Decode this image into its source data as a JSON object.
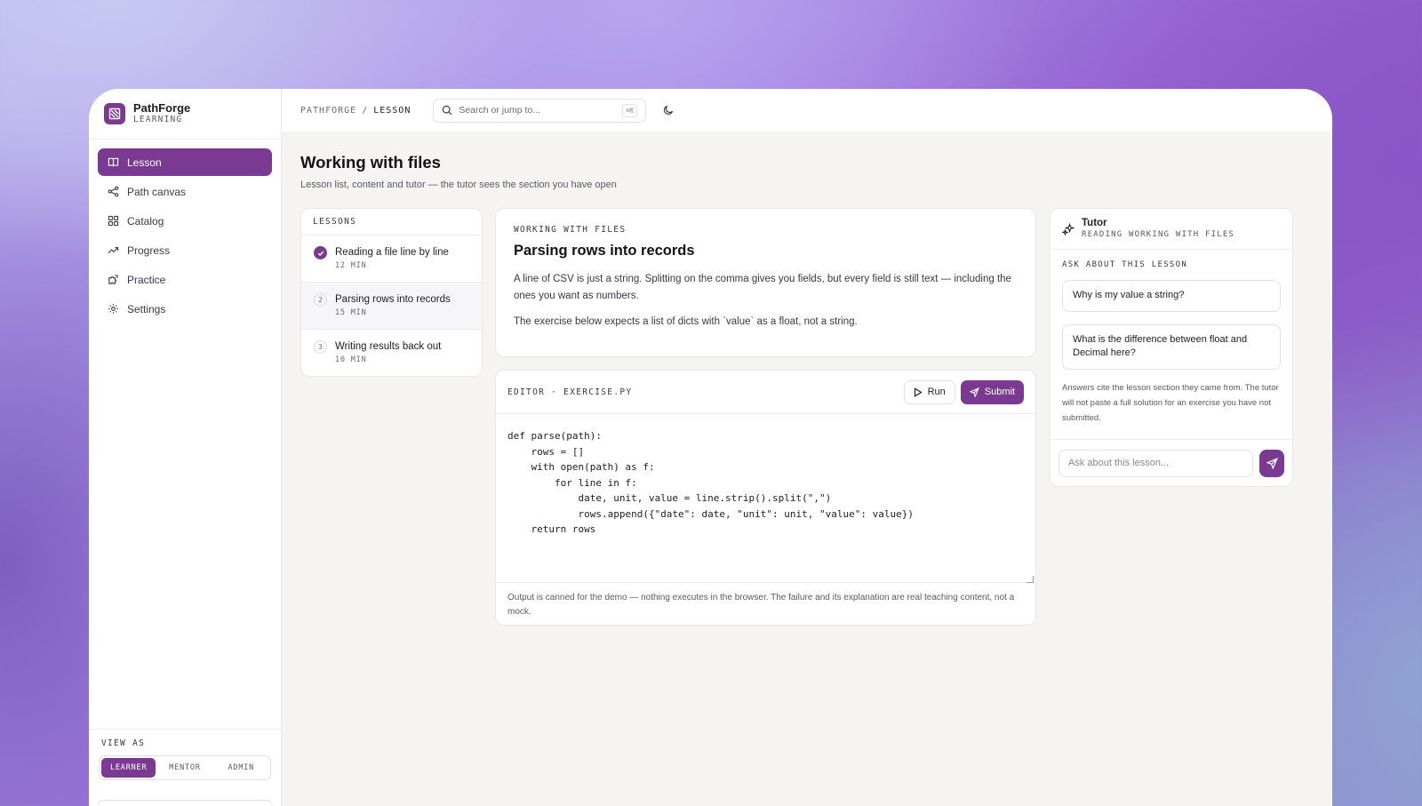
{
  "brand": {
    "name": "PathForge",
    "sub": "LEARNING"
  },
  "nav": [
    {
      "label": "Lesson",
      "icon": "book-icon",
      "active": true
    },
    {
      "label": "Path canvas",
      "icon": "share-nodes-icon"
    },
    {
      "label": "Catalog",
      "icon": "grid-icon"
    },
    {
      "label": "Progress",
      "icon": "trend-up-icon"
    },
    {
      "label": "Practice",
      "icon": "puzzle-icon"
    },
    {
      "label": "Settings",
      "icon": "gear-icon"
    }
  ],
  "view_as": {
    "label": "VIEW AS",
    "options": [
      "LEARNER",
      "MENTOR",
      "ADMIN"
    ],
    "selected": "LEARNER"
  },
  "topbar": {
    "crumb_root": "PATHFORGE",
    "crumb_sep": "/",
    "crumb_current": "LESSON",
    "search_placeholder": "Search or jump to...",
    "search_shortcut": "⌘K"
  },
  "page": {
    "title": "Working with files",
    "subtitle": "Lesson list, content and tutor — the tutor sees the section you have open"
  },
  "lessons": {
    "header": "LESSONS",
    "items": [
      {
        "marker": "✓",
        "title": "Reading a file line by line",
        "duration": "12 MIN",
        "status": "done"
      },
      {
        "marker": "2",
        "title": "Parsing rows into records",
        "duration": "15 MIN",
        "status": "current"
      },
      {
        "marker": "3",
        "title": "Writing results back out",
        "duration": "10 MIN",
        "status": "todo"
      }
    ]
  },
  "content": {
    "eyebrow": "WORKING WITH FILES",
    "title": "Parsing rows into records",
    "p1": "A line of CSV is just a string. Splitting on the comma gives you fields, but every field is still text — including the ones you want as numbers.",
    "p2": "The exercise below expects a list of dicts with `value` as a float, not a string."
  },
  "editor": {
    "label": "EDITOR · EXERCISE.PY",
    "run_label": "Run",
    "submit_label": "Submit",
    "code": "def parse(path):\n    rows = []\n    with open(path) as f:\n        for line in f:\n            date, unit, value = line.strip().split(\",\")\n            rows.append({\"date\": date, \"unit\": unit, \"value\": value})\n    return rows",
    "note": "Output is canned for the demo — nothing executes in the browser. The failure and its explanation are real teaching content, not a mock."
  },
  "tutor": {
    "name": "Tutor",
    "sub": "READING WORKING WITH FILES",
    "prompt_label": "ASK ABOUT THIS LESSON",
    "suggestions": [
      "Why is my value a string?",
      "What is the difference between float and Decimal here?"
    ],
    "note": "Answers cite the lesson section they came from. The tutor will not paste a full solution for an exercise you have not submitted.",
    "input_placeholder": "Ask about this lesson..."
  },
  "colors": {
    "accent": "#7a3a91",
    "panel": "#ffffff",
    "canvas": "#f5f4f2"
  }
}
